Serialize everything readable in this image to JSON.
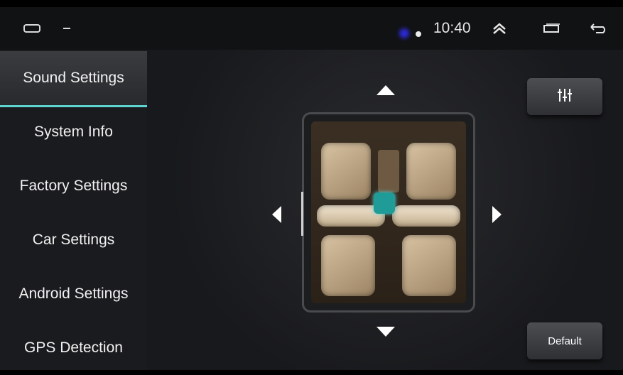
{
  "status": {
    "time": "10:40"
  },
  "sidebar": {
    "items": [
      {
        "label": "Sound Settings",
        "active": true
      },
      {
        "label": "System Info",
        "active": false
      },
      {
        "label": "Factory Settings",
        "active": false
      },
      {
        "label": "Car Settings",
        "active": false
      },
      {
        "label": "Android Settings",
        "active": false
      },
      {
        "label": "GPS Detection",
        "active": false
      }
    ]
  },
  "controls": {
    "default_label": "Default"
  },
  "icons": {
    "car": "car-icon",
    "signal": "signal-icon",
    "up": "chevron-up-icon",
    "window": "window-icon",
    "back": "back-icon",
    "eq": "equalizer-icon"
  },
  "colors": {
    "accent": "#5fd3d1",
    "sidebar_bg": "#1a1b1e",
    "statusbar_bg": "#111214",
    "main_bg": "#18191c"
  }
}
